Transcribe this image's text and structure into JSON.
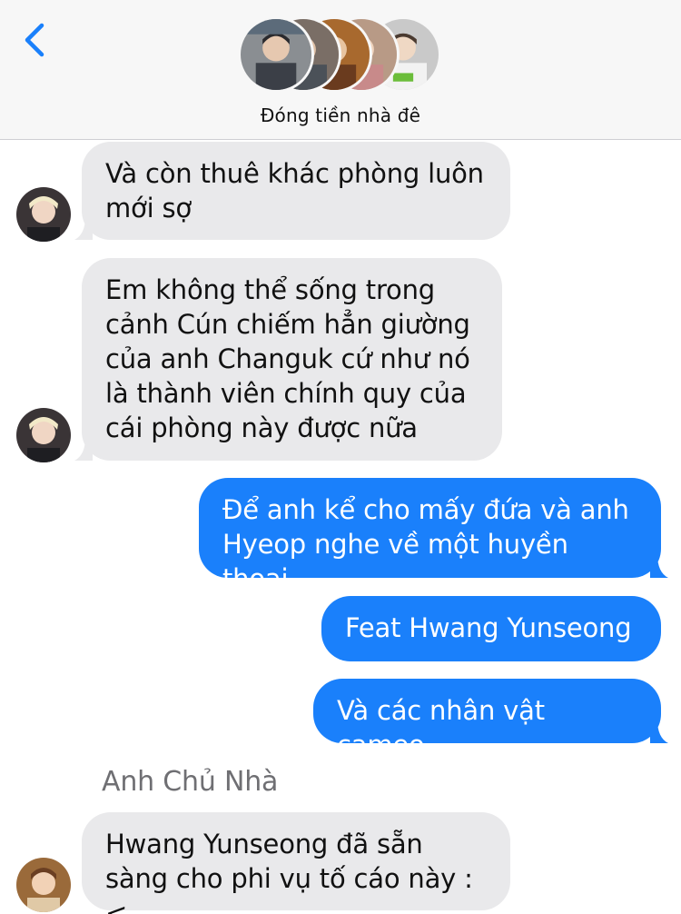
{
  "header": {
    "back_icon": "chevron-left-icon",
    "title": "Đóng tiền nhà đê",
    "accent": "#1a80fb"
  },
  "messages": [
    {
      "direction": "incoming",
      "text": "Và còn thuê khác phòng luôn\nmới sợ"
    },
    {
      "direction": "incoming",
      "text": "Em không thể sống trong\ncảnh Cún chiếm hẳn giường\ncủa anh Changuk cứ như nó\nlà thành viên chính quy của\ncái phòng này được nữa"
    },
    {
      "direction": "outgoing",
      "text": "Để anh kể cho mấy đứa và anh\nHyeop nghe về một huyền thoại"
    },
    {
      "direction": "outgoing",
      "text": "Feat Hwang Yunseong"
    },
    {
      "direction": "outgoing",
      "text": "Và các nhân vật cameo"
    },
    {
      "direction": "incoming",
      "sender": "Anh Chủ Nhà",
      "text": "Hwang Yunseong đã sẵn\nsàng cho phi vụ tố cáo này :<"
    }
  ],
  "colors": {
    "incoming_bubble": "#e9e9eb",
    "outgoing_bubble": "#1a80fb",
    "header_bg": "#f7f7f7"
  }
}
